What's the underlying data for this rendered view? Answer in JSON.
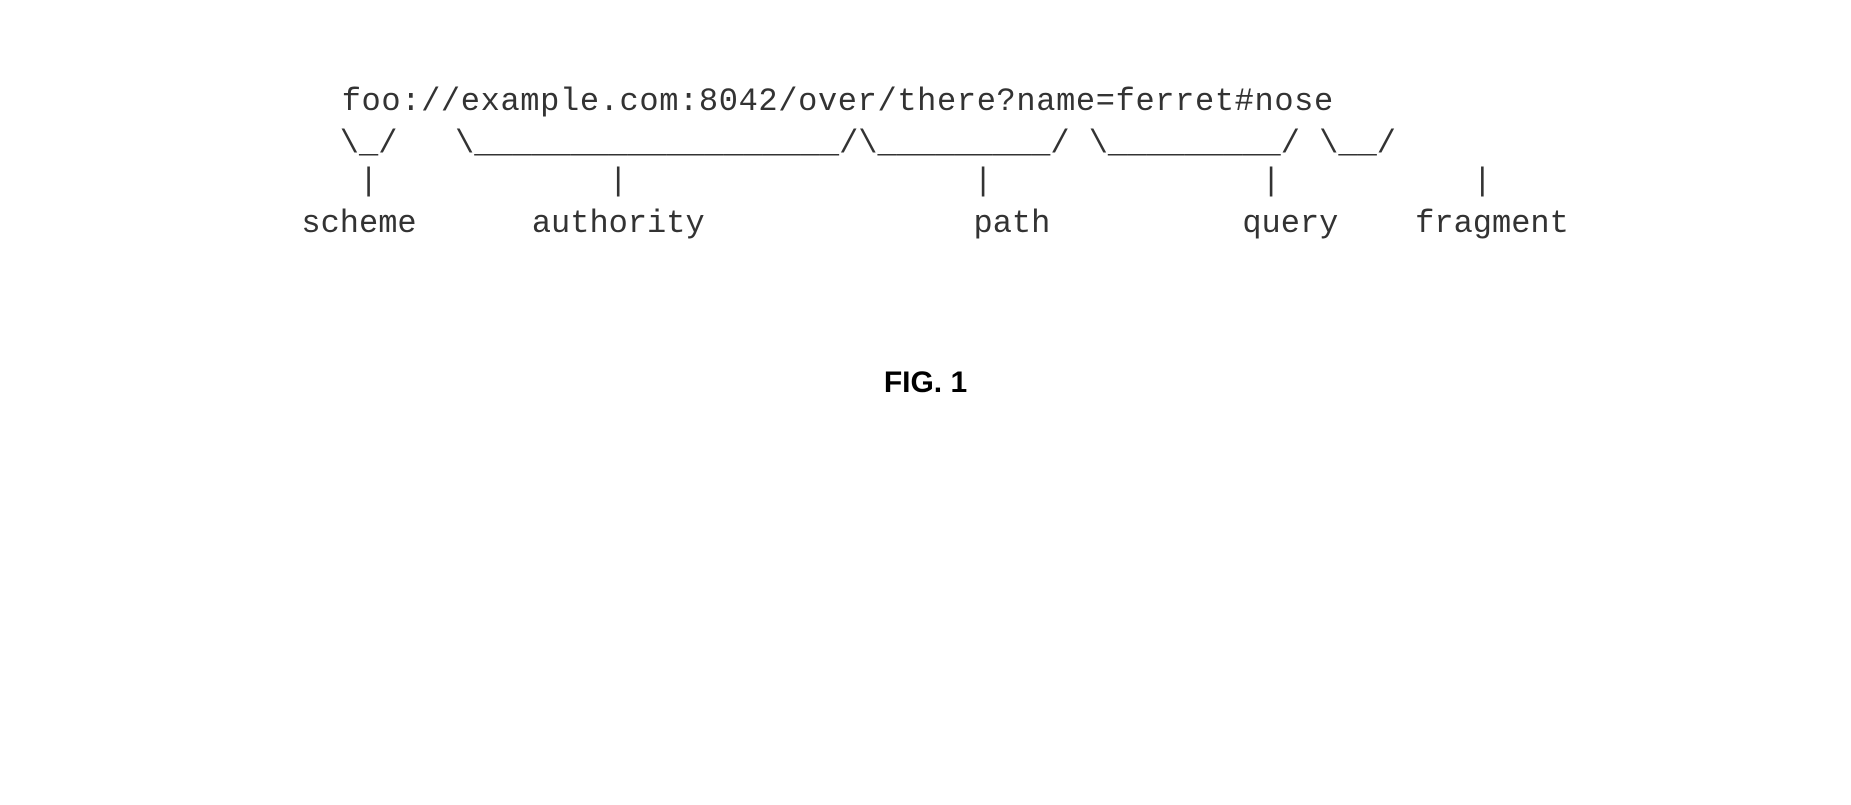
{
  "diagram": {
    "uri_line": "   foo://example.com:8042/over/there?name=ferret#nose",
    "bracket_line": "   \\_/   \\___________________/\\_________/ \\_________/ \\__/",
    "pipe_line": "    |            |                  |              |          |",
    "label_line": " scheme      authority              path          query    fragment"
  },
  "caption": {
    "text": "FIG. 1"
  }
}
